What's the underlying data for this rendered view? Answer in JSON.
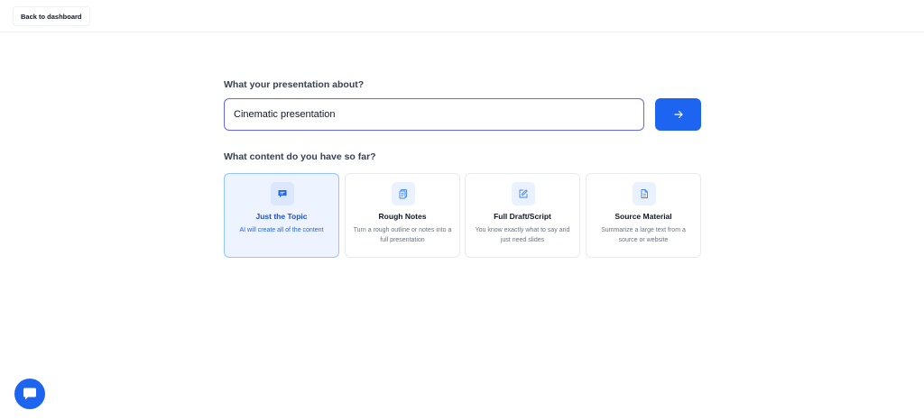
{
  "header": {
    "back_label": "Back to dashboard"
  },
  "topic": {
    "question": "What your presentation about?",
    "value": "Cinematic presentation",
    "submit_icon": "arrow-right-icon"
  },
  "content": {
    "question": "What content do you have so far?",
    "selected_index": 0,
    "options": [
      {
        "title": "Just the Topic",
        "description": "AI will create all of the content",
        "icon": "chat-bubble-icon"
      },
      {
        "title": "Rough Notes",
        "description": "Turn a rough outline or notes into a full presentation",
        "icon": "notes-icon"
      },
      {
        "title": "Full Draft/Script",
        "description": "You know exactly what to say and just need slides",
        "icon": "edit-icon"
      },
      {
        "title": "Source Material",
        "description": "Summarize a large text from a source or website",
        "icon": "document-icon"
      }
    ]
  },
  "chat": {
    "icon": "chat-icon"
  },
  "colors": {
    "accent": "#1d64f0",
    "input_border": "#6366f1",
    "selected_bg": "#edf4ff",
    "selected_border": "#93c5fd",
    "selected_text": "#1d4ed8"
  }
}
